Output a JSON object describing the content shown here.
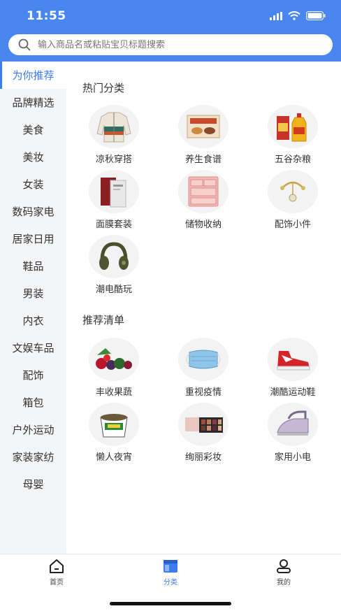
{
  "status_bar": {
    "time": "11:55"
  },
  "search": {
    "placeholder": "输入商品名或粘贴宝贝标题搜索"
  },
  "sidebar": {
    "items": [
      {
        "label": "为你推荐",
        "active": true
      },
      {
        "label": "品牌精选"
      },
      {
        "label": "美食"
      },
      {
        "label": "美妆"
      },
      {
        "label": "女装"
      },
      {
        "label": "数码家电"
      },
      {
        "label": "居家日用"
      },
      {
        "label": "鞋品"
      },
      {
        "label": "男装"
      },
      {
        "label": "内衣"
      },
      {
        "label": "文娱车品"
      },
      {
        "label": "配饰"
      },
      {
        "label": "箱包"
      },
      {
        "label": "户外运动"
      },
      {
        "label": "家装家纺"
      },
      {
        "label": "母婴"
      }
    ]
  },
  "hot": {
    "title": "热门分类",
    "items": [
      {
        "label": "凉秋穿搭",
        "icon": "jacket-icon"
      },
      {
        "label": "养生食谱",
        "icon": "food-box-icon"
      },
      {
        "label": "五谷杂粮",
        "icon": "oil-bottle-icon"
      },
      {
        "label": "面膜套装",
        "icon": "face-mask-icon"
      },
      {
        "label": "储物收纳",
        "icon": "storage-drawer-icon"
      },
      {
        "label": "配饰小件",
        "icon": "bracelet-icon"
      },
      {
        "label": "潮电酷玩",
        "icon": "headphones-icon"
      }
    ]
  },
  "recommend": {
    "title": "推荐清单",
    "items": [
      {
        "label": "丰收果蔬",
        "icon": "fruit-icon"
      },
      {
        "label": "重视疫情",
        "icon": "surgical-mask-icon"
      },
      {
        "label": "潮酷运动鞋",
        "icon": "sneaker-icon"
      },
      {
        "label": "懒人夜宵",
        "icon": "snack-bowl-icon"
      },
      {
        "label": "绚丽彩妆",
        "icon": "eyeshadow-palette-icon"
      },
      {
        "label": "家用小电",
        "icon": "iron-icon"
      }
    ]
  },
  "tabbar": {
    "tabs": [
      {
        "label": "首页",
        "icon": "home-icon"
      },
      {
        "label": "分类",
        "icon": "category-icon",
        "active": true
      },
      {
        "label": "我的",
        "icon": "user-icon"
      }
    ]
  },
  "colors": {
    "header": "#4a86f0",
    "accent": "#3b7cf0",
    "sidebar_bg": "#f4f5f7"
  }
}
